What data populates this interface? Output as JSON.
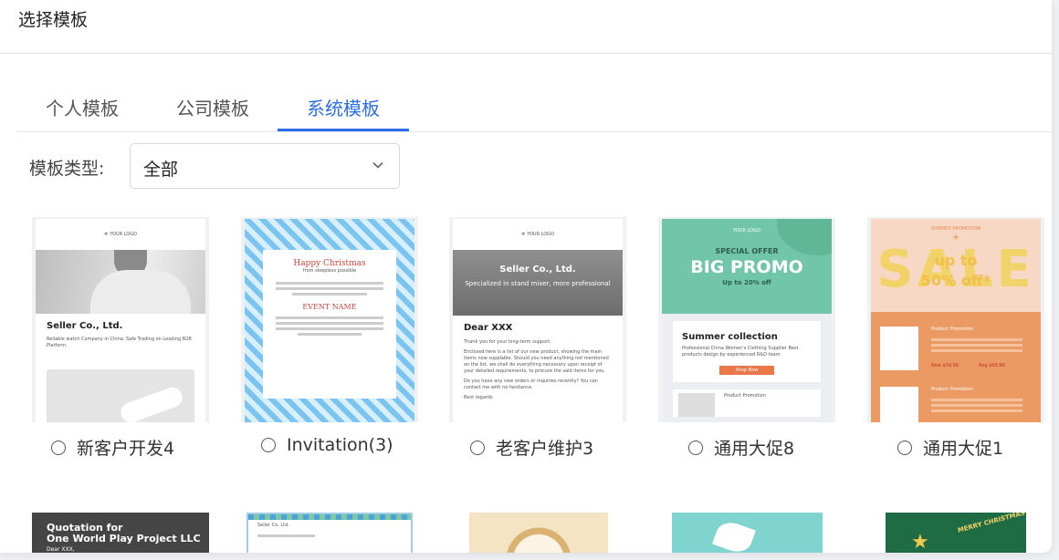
{
  "dialog": {
    "title": "选择模板"
  },
  "tabs": [
    {
      "label": "个人模板",
      "active": false
    },
    {
      "label": "公司模板",
      "active": false
    },
    {
      "label": "系统模板",
      "active": true
    }
  ],
  "filter": {
    "label": "模板类型:",
    "value": "全部"
  },
  "templates": [
    {
      "name": "新客户开发4",
      "thumb": {
        "logo": "YOUR LOGO",
        "company": "Seller Co., Ltd.",
        "desc": "Reliable watch Company in China. Safe Trading on Leading B2B Platform."
      }
    },
    {
      "name": "Invitation(3)",
      "thumb": {
        "heading": "Happy Christmas",
        "subheading": "from sleepless possible",
        "event": "EVENT NAME"
      }
    },
    {
      "name": "老客户维护3",
      "thumb": {
        "logo": "YOUR LOGO",
        "company": "Seller Co., Ltd.",
        "tagline": "Specialized in stand mixer, more professional",
        "greeting": "Dear XXX",
        "p1": "Thank you for your long-term support.",
        "p2": "Enclosed here is a list of our new product, showing the main items now supplable. Should you need anything not mentioned on the list, we shall do everything necessary upon receipt of your detailed requirements, to procure the said items for you.",
        "p3": "Do you have any new orders or inquiries recently? You can contact me with no hesitance.",
        "p4": "Best regards"
      }
    },
    {
      "name": "通用大促8",
      "thumb": {
        "logo": "YOUR LOGO",
        "offer": "SPECIAL OFFER",
        "promo": "BIG PROMO",
        "upto": "Up to 20% off",
        "collection": "Summer collection",
        "collection_desc": "Professional China Women's Clothing Supplier Best products design by experienced R&D team",
        "shop": "Shop Now",
        "product": "Product Promotion"
      }
    },
    {
      "name": "通用大促1",
      "thumb": {
        "kicker": "SUMMER PROMOTION",
        "sale": "SALE",
        "upto": "up to",
        "off": "50% off*",
        "p1": "Product Promotion",
        "price": "Now $39.99",
        "was": "Reg $69.99",
        "p2": "Product Promotion"
      }
    }
  ],
  "row2": [
    {
      "title1": "Quotation for",
      "title2": "One World Play Project LLC",
      "sub": "Dear XXX,"
    },
    {
      "text": "Seller Co. Ltd."
    },
    {
      "text": ""
    },
    {
      "text": ""
    },
    {
      "text": "MERRY CHRISTMAS"
    }
  ]
}
